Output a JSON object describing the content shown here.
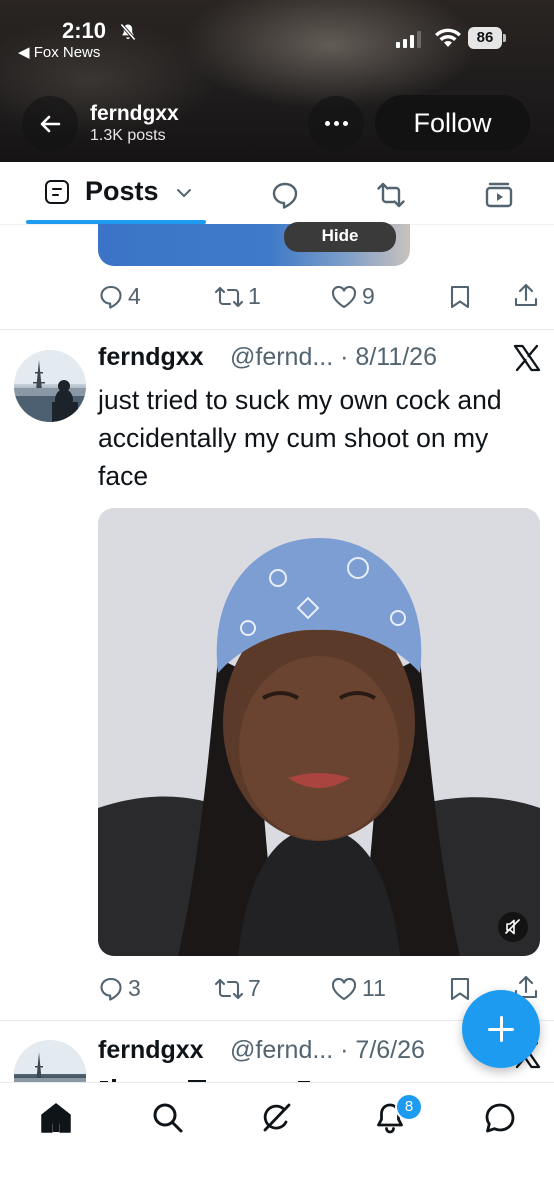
{
  "status_bar": {
    "time": "2:10",
    "back_app": "◀ Fox News",
    "battery": "86"
  },
  "profile_header": {
    "name": "ferndgxx",
    "posts_count": "1.3K posts",
    "follow_label": "Follow"
  },
  "tabs": {
    "active_label": "Posts",
    "icons": [
      "posts-icon",
      "chevron-down-icon",
      "reply-icon",
      "repost-icon",
      "media-icon"
    ]
  },
  "prev_tweet": {
    "hide_label": "Hide",
    "replies": "4",
    "reposts": "1",
    "likes": "9"
  },
  "tweet": {
    "name": "ferndgxx",
    "handle_date": "@fernd... · 8/11/26",
    "text": "just tried to suck my own cock and accidentally my cum shoot on my face",
    "replies": "3",
    "reposts": "7",
    "likes": "11",
    "video_muted": true
  },
  "next_tweet": {
    "name": "ferndgxx",
    "handle_date": "@fernd... · 7/6/26"
  },
  "bottom_nav": {
    "items": [
      "home-icon",
      "search-icon",
      "grok-icon",
      "notifications-icon",
      "messages-icon"
    ],
    "notification_count": "8"
  },
  "colors": {
    "accent": "#1d9bf0",
    "text_primary": "#0f1419",
    "text_secondary": "#536471"
  }
}
